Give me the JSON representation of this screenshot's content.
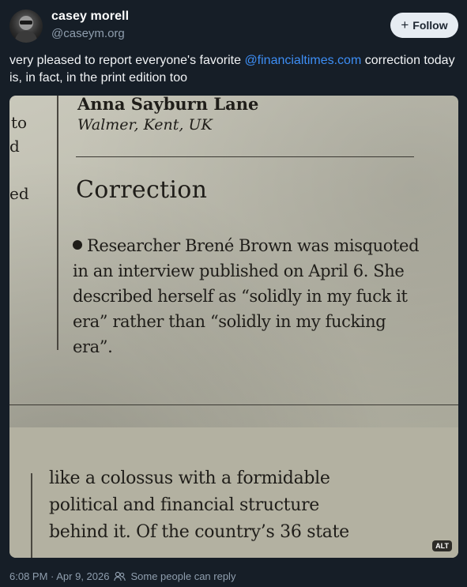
{
  "author": {
    "display_name": "casey morell",
    "handle": "@caseym.org"
  },
  "follow_button": {
    "icon": "plus-icon",
    "label": "Follow"
  },
  "post": {
    "text_before": "very pleased to report everyone's favorite ",
    "mention": "@financialtimes.com",
    "text_after": " correction today is, in fact, in the print edition too"
  },
  "image": {
    "alt_badge": "ALT",
    "newspaper": {
      "signature_name": "Anna Sayburn Lane",
      "signature_place": "Walmer, Kent, UK",
      "left_fragments": [
        "to",
        "d",
        "ed"
      ],
      "heading": "Correction",
      "body": "Researcher Brené Brown was misquoted in an interview published on April 6. She described herself as “solidly in my fuck it era” rather than “solidly in my fucking era”.",
      "lower_text": "like a colossus with a formidable\npolitical and financial structure\nbehind it. Of the country’s 36 state"
    }
  },
  "footer": {
    "timestamp": "6:08 PM · Apr 9, 2026",
    "reply_icon": "people-icon",
    "reply_setting": "Some people can reply"
  },
  "colors": {
    "background": "#161e27",
    "link": "#3d8ef5",
    "muted": "#8f9eae",
    "button_bg": "#e6ecf2"
  }
}
